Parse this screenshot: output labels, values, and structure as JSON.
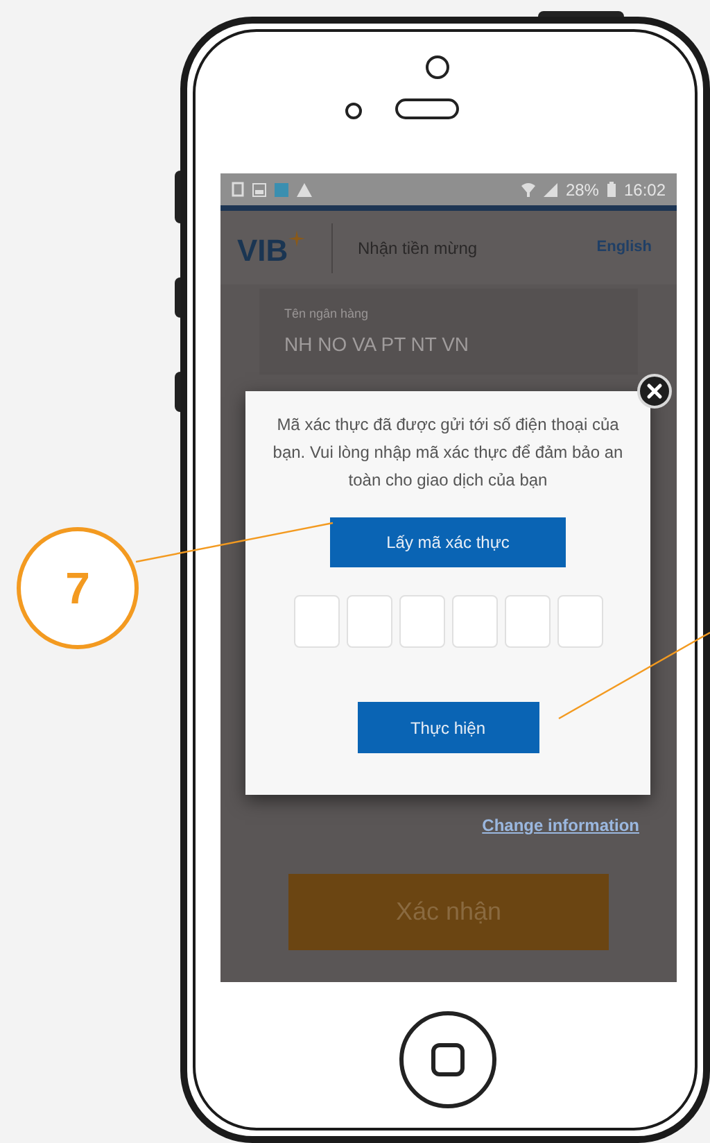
{
  "annotation": {
    "number": "7"
  },
  "status_bar": {
    "battery": "28%",
    "time": "16:02"
  },
  "header": {
    "logo": "VIB",
    "title": "Nhận tiền mừng",
    "language_link": "English"
  },
  "bank_field": {
    "label": "Tên ngân hàng",
    "value": "NH NO VA PT NT VN"
  },
  "dialog": {
    "message": "Mã xác thực đã được gửi tới số điện thoại của bạn. Vui lòng nhập mã xác thực để đảm bảo an toàn cho giao dịch của bạn",
    "get_code_button": "Lấy mã xác thực",
    "code_boxes": [
      {
        "filled": false
      },
      {
        "filled": false
      },
      {
        "filled": false
      },
      {
        "filled": false
      },
      {
        "filled": false
      },
      {
        "filled": false
      }
    ],
    "submit_button": "Thực hiện"
  },
  "change_link": "Change information",
  "confirm_button": "Xác nhận"
}
